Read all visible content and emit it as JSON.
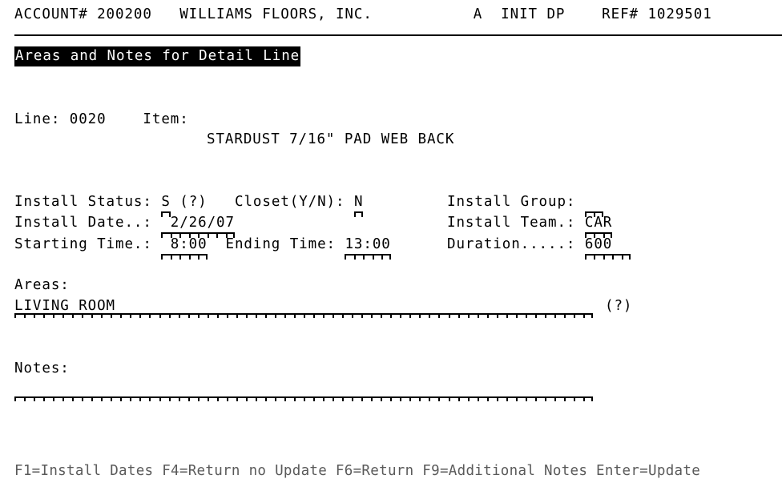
{
  "screen": {
    "title": "Areas and Notes for Detail Line",
    "colors": {
      "foreground": "#000000",
      "background": "#ffffff",
      "function_keys": "#5a5a5a",
      "reverse_video_bg": "#000000",
      "reverse_video_fg": "#ffffff"
    }
  },
  "header": {
    "account_label": "ACCOUNT#",
    "account_number": "200200",
    "company_name": "WILLIAMS FLOORS, INC.",
    "mode_code": "A",
    "init_label": "INIT",
    "init_value": "DP",
    "ref_label": "REF#",
    "ref_number": "1029501",
    "full_line": "ACCOUNT# 200200   WILLIAMS FLOORS, INC.           A  INIT DP    REF# 1029501"
  },
  "detail": {
    "line_label": "Line:",
    "line_value": "0020",
    "item_label": "Item:",
    "item_description": "STARDUST 7/16\" PAD WEB BACK"
  },
  "fields": {
    "install_status": {
      "label": "Install Status:",
      "value": "S",
      "width": 1,
      "prompt": "(?)"
    },
    "closet": {
      "label": "Closet(Y/N):",
      "value": "N",
      "width": 1
    },
    "install_group": {
      "label": "Install Group:",
      "value": "  ",
      "width": 2
    },
    "install_date": {
      "label": "Install Date..:",
      "value": " 2/26/07",
      "width": 8
    },
    "install_team": {
      "label": "Install Team.:",
      "value": "CAR",
      "width": 3
    },
    "starting_time": {
      "label": "Starting Time.:",
      "value": " 8:00",
      "width": 5
    },
    "ending_time": {
      "label": "Ending Time:",
      "value": "13:00",
      "width": 5
    },
    "duration": {
      "label": "Duration.....:",
      "value": "600  ",
      "width": 5
    },
    "areas": {
      "label": "Areas:",
      "value": "LIVING ROOM",
      "width": 60,
      "prompt": "(?)"
    },
    "notes": {
      "label": "Notes:",
      "value": "",
      "width": 60
    }
  },
  "function_keys": {
    "full_line": "F1=Install Dates F4=Return no Update F6=Return F9=Additional Notes Enter=Update",
    "items": [
      {
        "key": "F1",
        "action": "Install Dates"
      },
      {
        "key": "F4",
        "action": "Return no Update"
      },
      {
        "key": "F6",
        "action": "Return"
      },
      {
        "key": "F9",
        "action": "Additional Notes"
      },
      {
        "key": "Enter",
        "action": "Update"
      }
    ]
  }
}
